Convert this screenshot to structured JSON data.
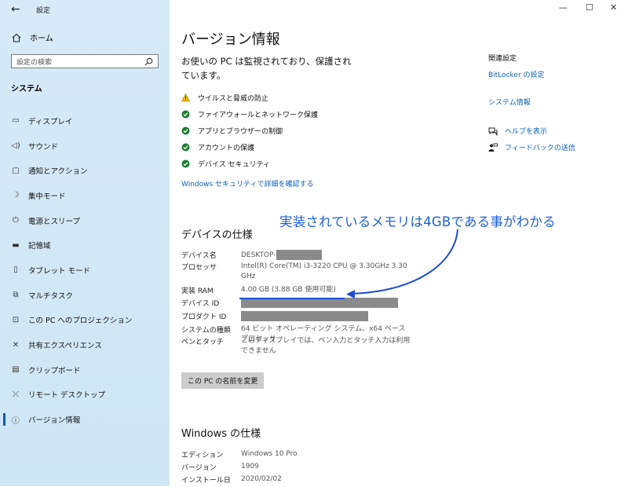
{
  "window": {
    "title": "設定",
    "controls": [
      "—",
      "☐",
      "✕"
    ]
  },
  "sidebar": {
    "home": "ホーム",
    "search_placeholder": "設定の検索",
    "section": "システム",
    "items": [
      {
        "label": "ディスプレイ",
        "icon": "display-icon"
      },
      {
        "label": "サウンド",
        "icon": "sound-icon"
      },
      {
        "label": "通知とアクション",
        "icon": "notification-icon"
      },
      {
        "label": "集中モード",
        "icon": "moon-icon"
      },
      {
        "label": "電源とスリープ",
        "icon": "power-icon"
      },
      {
        "label": "記憶域",
        "icon": "storage-icon"
      },
      {
        "label": "タブレット モード",
        "icon": "tablet-icon"
      },
      {
        "label": "マルチタスク",
        "icon": "multitask-icon"
      },
      {
        "label": "この PC へのプロジェクション",
        "icon": "projection-icon"
      },
      {
        "label": "共有エクスペリエンス",
        "icon": "share-icon"
      },
      {
        "label": "クリップボード",
        "icon": "clipboard-icon"
      },
      {
        "label": "リモート デスクトップ",
        "icon": "remote-desktop-icon"
      },
      {
        "label": "バージョン情報",
        "icon": "info-icon",
        "active": true
      }
    ]
  },
  "main": {
    "title": "バージョン情報",
    "lead_line1": "お使いの PC は監視されており、保護され",
    "lead_line2": "ています。",
    "security": [
      {
        "label": "ウイルスと脅威の防止",
        "status": "warning"
      },
      {
        "label": "ファイアウォールとネットワーク保護",
        "status": "ok"
      },
      {
        "label": "アプリとブラウザーの制御",
        "status": "ok"
      },
      {
        "label": "アカウントの保護",
        "status": "ok"
      },
      {
        "label": "デバイス セキュリティ",
        "status": "ok"
      }
    ],
    "security_link": "Windows セキュリティで詳細を確認する",
    "device_heading": "デバイスの仕様",
    "device_specs": {
      "name_label": "デバイス名",
      "name_value": "DESKTOP-",
      "cpu_label": "プロセッサ",
      "cpu_value": "Intel(R) Core(TM) i3-3220 CPU @ 3.30GHz   3.30 GHz",
      "ram_label": "実装 RAM",
      "ram_value": "4.00 GB (3.88 GB 使用可能)",
      "devid_label": "デバイス ID",
      "prodid_label": "プロダクト ID",
      "type_label": "システムの種類",
      "type_value": "64 ビット オペレーティング システム、x64 ベース プロセッサ",
      "pen_label": "ペンとタッチ",
      "pen_value": "このディスプレイでは、ペン入力とタッチ入力は利用できません"
    },
    "rename_button": "この PC の名前を変更",
    "windows_heading": "Windows の仕様",
    "windows_specs": {
      "edition_label": "エディション",
      "edition_value": "Windows 10 Pro",
      "version_label": "バージョン",
      "version_value": "1909",
      "install_label": "インストール日",
      "install_value": "2020/02/02"
    }
  },
  "related": {
    "heading": "関連設定",
    "bitlocker": "BitLocker の設定",
    "sysinfo": "システム情報",
    "help": "ヘルプを表示",
    "feedback": "フィードバックの送信"
  },
  "annotation": {
    "text": "実装されているメモリは4GBである事がわかる",
    "color": "#1d5fd6"
  },
  "colors": {
    "accent": "#0a62b5",
    "sidebar_bg": "#d6eaf8",
    "warning": "#f2c200",
    "ok": "#1e7d32"
  }
}
